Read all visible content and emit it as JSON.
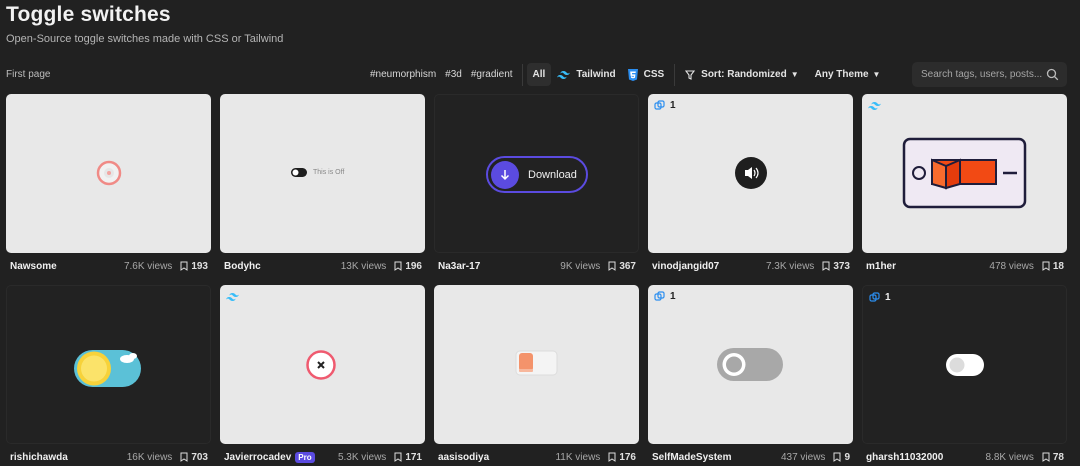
{
  "header": {
    "title": "Toggle switches",
    "subtitle": "Open-Source toggle switches made with CSS or Tailwind",
    "first_page": "First page"
  },
  "filters": {
    "tags": [
      "#neumorphism",
      "#3d",
      "#gradient"
    ],
    "all": "All",
    "tailwind": "Tailwind",
    "css": "CSS",
    "sort": "Sort: Randomized",
    "theme": "Any Theme",
    "search_placeholder": "Search tags, users, posts..."
  },
  "colors": {
    "tailwind": "#38bdf8",
    "css": "#2b8ef0",
    "pro": "#5b4be0",
    "download": "#5b4be0"
  },
  "cards": [
    {
      "author": "Nawsome",
      "views": "7.6K views",
      "saves": "193"
    },
    {
      "author": "Bodyhc",
      "views": "13K views",
      "saves": "196",
      "preview_text": "This is Off"
    },
    {
      "author": "Na3ar-17",
      "views": "9K views",
      "saves": "367",
      "preview_text": "Download"
    },
    {
      "author": "vinodjangid07",
      "views": "7.3K views",
      "saves": "373",
      "badge": "1"
    },
    {
      "author": "m1her",
      "views": "478 views",
      "saves": "18"
    },
    {
      "author": "rishichawda",
      "views": "16K views",
      "saves": "703"
    },
    {
      "author": "Javierrocadev",
      "views": "5.3K views",
      "saves": "171",
      "pro": "Pro"
    },
    {
      "author": "aasisodiya",
      "views": "11K views",
      "saves": "176"
    },
    {
      "author": "SelfMadeSystem",
      "views": "437 views",
      "saves": "9",
      "badge": "1"
    },
    {
      "author": "gharsh11032000",
      "views": "8.8K views",
      "saves": "78",
      "badge": "1"
    }
  ]
}
